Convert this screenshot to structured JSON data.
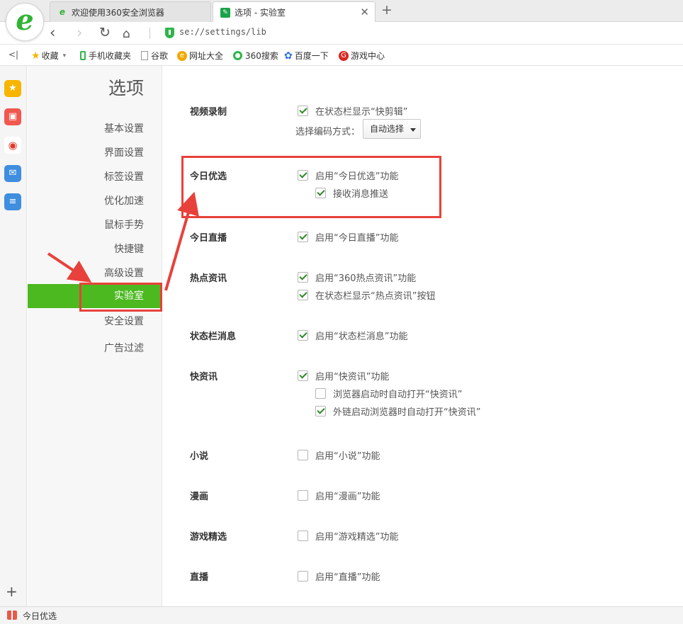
{
  "browser": {
    "tabs": [
      {
        "title": "欢迎使用360安全浏览器"
      },
      {
        "title": "选项 - 实验室"
      }
    ],
    "address": "se://settings/lib",
    "bookmarks": [
      "收藏",
      "手机收藏夹",
      "谷歌",
      "网址大全",
      "360搜索",
      "百度一下",
      "游戏中心"
    ]
  },
  "settings": {
    "title": "选项",
    "nav": [
      "基本设置",
      "界面设置",
      "标签设置",
      "优化加速",
      "鼠标手势",
      "快捷键",
      "高级设置",
      "实验室",
      "安全设置",
      "广告过滤"
    ],
    "active_nav": "实验室"
  },
  "content": {
    "video": {
      "label": "视频录制",
      "opt1": "在状态栏显示“快剪辑”",
      "opt1_checked": true,
      "encode_label": "选择编码方式：",
      "encode_value": "自动选择"
    },
    "today": {
      "label": "今日优选",
      "opt1": "启用“今日优选”功能",
      "opt1_checked": true,
      "opt2": "接收消息推送",
      "opt2_checked": true
    },
    "live_today": {
      "label": "今日直播",
      "opt1": "启用“今日直播”功能",
      "opt1_checked": true
    },
    "hot": {
      "label": "热点资讯",
      "opt1": "启用“360热点资讯”功能",
      "opt1_checked": true,
      "opt2": "在状态栏显示“热点资讯”按钮",
      "opt2_checked": true
    },
    "status_msg": {
      "label": "状态栏消息",
      "opt1": "启用“状态栏消息”功能",
      "opt1_checked": true
    },
    "news": {
      "label": "快资讯",
      "opt1": "启用“快资讯”功能",
      "opt1_checked": true,
      "opt2": "浏览器启动时自动打开“快资讯”",
      "opt2_checked": false,
      "opt3": "外链启动浏览器时自动打开“快资讯”",
      "opt3_checked": true
    },
    "novel": {
      "label": "小说",
      "opt1": "启用“小说”功能",
      "opt1_checked": false
    },
    "comic": {
      "label": "漫画",
      "opt1": "启用“漫画”功能",
      "opt1_checked": false
    },
    "games": {
      "label": "游戏精选",
      "opt1": "启用“游戏精选”功能",
      "opt1_checked": false
    },
    "live": {
      "label": "直播",
      "opt1": "启用“直播”功能",
      "opt1_checked": false
    }
  },
  "statusbar": {
    "text": "今日优选"
  },
  "colors": {
    "accent": "#4bb91f",
    "annotation": "#e8413b"
  }
}
